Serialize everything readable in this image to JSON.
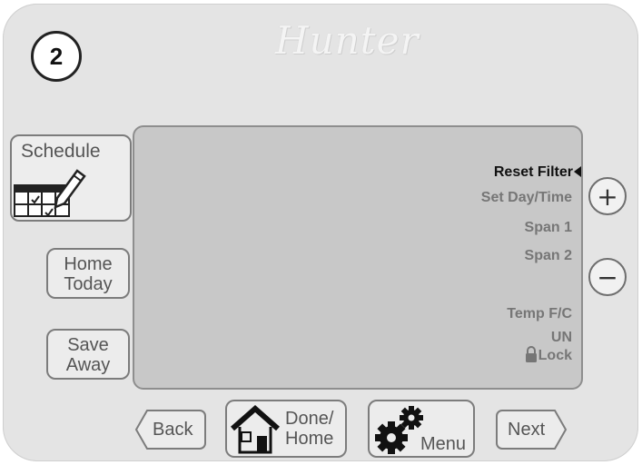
{
  "step": {
    "number": "2"
  },
  "brand": {
    "name": "Hunter"
  },
  "sidebar": {
    "schedule": "Schedule",
    "home_today": [
      "Home",
      "Today"
    ],
    "save_away": [
      "Save",
      "Away"
    ]
  },
  "screen": {
    "menu": [
      {
        "label": "Reset Filter",
        "active": true
      },
      {
        "label": "Set Day/Time",
        "active": false
      },
      {
        "label": "Span 1",
        "active": false
      },
      {
        "label": "Span 2",
        "active": false
      },
      {
        "label": "Temp F/C",
        "active": false
      }
    ],
    "lock": {
      "top": "UN",
      "bottom": "Lock"
    }
  },
  "controls": {
    "plus": "+",
    "minus": "−"
  },
  "bottom": {
    "back": "Back",
    "done_home": [
      "Done/",
      "Home"
    ],
    "menu": "Menu",
    "next": "Next"
  },
  "colors": {
    "active_text": "#111111",
    "inactive_text": "#767676",
    "screen_bg": "#c8c8c8",
    "device_bg": "#e4e4e4"
  },
  "icons": [
    "calendar-pencil-icon",
    "house-icon",
    "gears-icon",
    "lock-icon",
    "selection-arrow-icon"
  ]
}
